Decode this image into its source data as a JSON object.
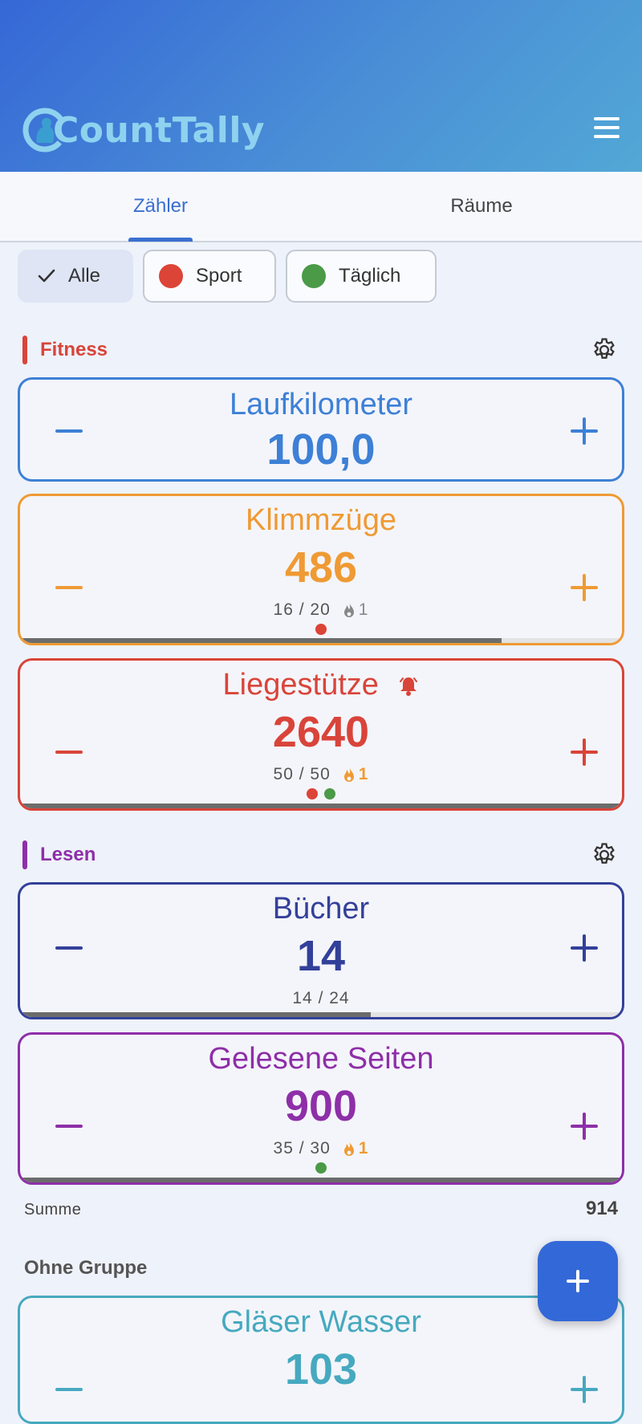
{
  "app": {
    "logo_text": "CountTally",
    "logo_letter": "C"
  },
  "header": {
    "menu_icon": "hamburger-menu-icon"
  },
  "tabs": [
    {
      "label": "Zähler",
      "active": true
    },
    {
      "label": "Räume",
      "active": false
    }
  ],
  "filters": [
    {
      "label": "Alle",
      "selected": true,
      "icon": "check-icon"
    },
    {
      "label": "Sport",
      "selected": false,
      "color": "#dc4437"
    },
    {
      "label": "Täglich",
      "selected": false,
      "color": "#4a9a48"
    }
  ],
  "groups": [
    {
      "name": "Fitness",
      "color": "#d9443a",
      "counters": [
        {
          "title": "Laufkilometer",
          "value": "100,0",
          "color": "#3d80d6"
        },
        {
          "title": "Klimmzüge",
          "value": "486",
          "color": "#ef9a34",
          "goal": "16 / 20",
          "streak": "1",
          "streak_active": false,
          "progress": 0.8,
          "dots": [
            "#dc4437"
          ]
        },
        {
          "title": "Liegestütze",
          "value": "2640",
          "color": "#d9443a",
          "goal": "50 / 50",
          "streak": "1",
          "streak_active": true,
          "progress": 1.0,
          "dots": [
            "#dc4437",
            "#4a9a48"
          ],
          "alarm": true
        }
      ]
    },
    {
      "name": "Lesen",
      "color": "#8e2fa8",
      "counters": [
        {
          "title": "Bücher",
          "value": "14",
          "color": "#33409a",
          "goal": "14 / 24",
          "progress": 0.583
        },
        {
          "title": "Gelesene Seiten",
          "value": "900",
          "color": "#8e2fa8",
          "goal": "35 / 30",
          "streak": "1",
          "streak_active": true,
          "progress": 1.0,
          "dots": [
            "#4a9a48"
          ]
        }
      ],
      "sum_label": "Summe",
      "sum_value": "914"
    }
  ],
  "ungrouped": {
    "label": "Ohne Gruppe",
    "counters": [
      {
        "title": "Gläser Wasser",
        "value": "103",
        "color": "#46a9bf"
      }
    ]
  },
  "fab": {
    "icon": "plus-icon"
  },
  "streak_color_active": "#ef9a34",
  "streak_color_inactive": "#888888"
}
